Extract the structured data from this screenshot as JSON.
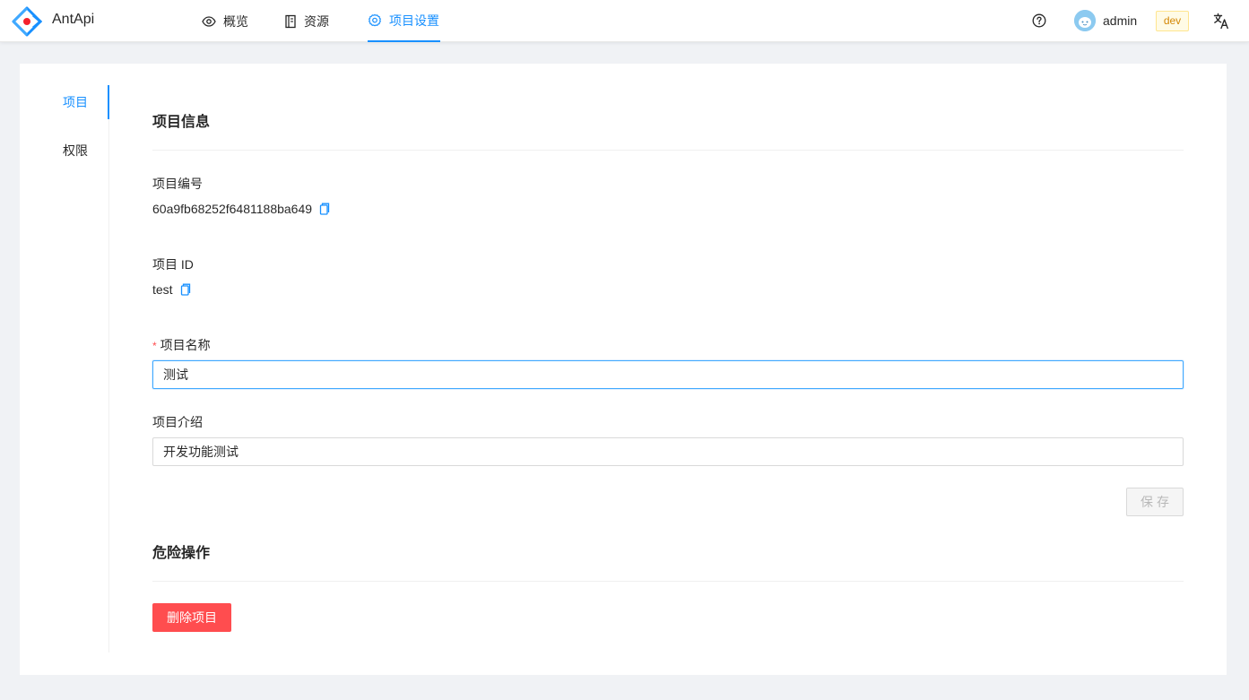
{
  "header": {
    "brand": "AntApi",
    "nav": [
      {
        "label": "概览",
        "icon": "eye-icon"
      },
      {
        "label": "资源",
        "icon": "book-icon"
      },
      {
        "label": "项目设置",
        "icon": "gear-icon",
        "active": true
      }
    ],
    "username": "admin",
    "env": "dev",
    "accent_color": "#1890ff"
  },
  "side_menu": {
    "items": [
      {
        "label": "项目",
        "active": true
      },
      {
        "label": "权限",
        "active": false
      }
    ]
  },
  "project_info": {
    "title": "项目信息",
    "number_label": "项目编号",
    "number_value": "60a9fb68252f6481188ba649",
    "id_label": "项目 ID",
    "id_value": "test",
    "name_label": "项目名称",
    "name_value": "测试",
    "intro_label": "项目介绍",
    "intro_value": "开发功能测试",
    "save_label": "保存"
  },
  "danger_zone": {
    "title": "危险操作",
    "delete_label": "删除项目",
    "danger_color": "#ff4d4f"
  }
}
